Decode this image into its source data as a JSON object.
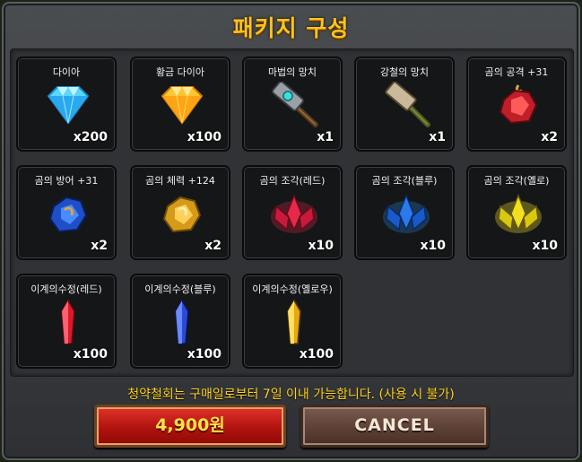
{
  "title": "패키지 구성",
  "items": [
    {
      "name": "다이아",
      "qty": "x200",
      "icon": "diamond-blue-icon"
    },
    {
      "name": "황금 다이아",
      "qty": "x100",
      "icon": "diamond-gold-icon"
    },
    {
      "name": "마법의 망치",
      "qty": "x1",
      "icon": "magic-hammer-icon"
    },
    {
      "name": "강철의 망치",
      "qty": "x1",
      "icon": "steel-hammer-icon"
    },
    {
      "name": "곰의 공격 +31",
      "qty": "x2",
      "icon": "bear-attack-icon"
    },
    {
      "name": "곰의 방어 +31",
      "qty": "x2",
      "icon": "bear-defense-icon"
    },
    {
      "name": "곰의 체력 +124",
      "qty": "x2",
      "icon": "bear-health-icon"
    },
    {
      "name": "곰의 조각(레드)",
      "qty": "x10",
      "icon": "red-shard-icon"
    },
    {
      "name": "곰의 조각(블루)",
      "qty": "x10",
      "icon": "blue-shard-icon"
    },
    {
      "name": "곰의 조각(옐로)",
      "qty": "x10",
      "icon": "yellow-shard-icon"
    },
    {
      "name": "이계의수정(레드)",
      "qty": "x100",
      "icon": "red-crystal-icon"
    },
    {
      "name": "이계의수정(블루)",
      "qty": "x100",
      "icon": "blue-crystal-icon"
    },
    {
      "name": "이계의수정(옐로우)",
      "qty": "x100",
      "icon": "yellow-crystal-icon"
    }
  ],
  "notice": "청약철회는 구매일로부터 7일 이내 가능합니다. (사용 시 불가)",
  "buttons": {
    "buy": "4,900원",
    "cancel": "CANCEL"
  },
  "colors": {
    "title": "#ffc21a",
    "notice": "#ffd21e",
    "buy_bg": "#c41a12",
    "cancel_bg": "#5d4136"
  }
}
